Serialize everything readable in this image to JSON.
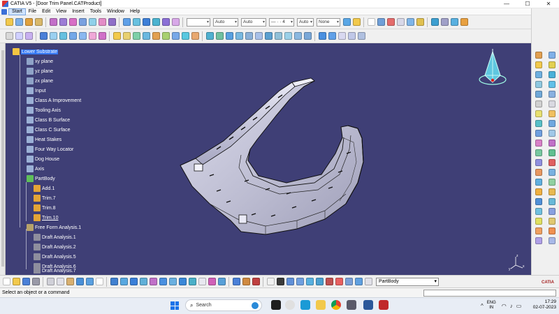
{
  "window": {
    "title": "CATIA V5 - [Door Trim Panel.CATProduct]",
    "controls": [
      "—",
      "☐",
      "✕"
    ]
  },
  "menu": {
    "items": [
      "Start",
      "File",
      "Edit",
      "View",
      "Insert",
      "Tools",
      "Window",
      "Help"
    ]
  },
  "toolbar": {
    "combos": [
      "",
      "Auto",
      "Auto",
      "— · · 4",
      "Auto",
      "None"
    ]
  },
  "tree": {
    "nodes": [
      {
        "label": "Lower Substrate",
        "icon_color": "#f4c542"
      },
      {
        "label": "xy plane",
        "icon_color": "#8fa3c8"
      },
      {
        "label": "yz plane",
        "icon_color": "#8fa3c8"
      },
      {
        "label": "zx plane",
        "icon_color": "#8fa3c8"
      },
      {
        "label": "Input",
        "icon_color": "#9bb0d6"
      },
      {
        "label": "Class A Improvement",
        "icon_color": "#9bb0d6"
      },
      {
        "label": "Tooling Axis",
        "icon_color": "#9bb0d6"
      },
      {
        "label": "Class B Surface",
        "icon_color": "#9bb0d6"
      },
      {
        "label": "Class C Surface",
        "icon_color": "#9bb0d6"
      },
      {
        "label": "Heat Stakes",
        "icon_color": "#9bb0d6"
      },
      {
        "label": "Four Way Locator",
        "icon_color": "#9bb0d6"
      },
      {
        "label": "Dog House",
        "icon_color": "#9bb0d6"
      },
      {
        "label": "Axis",
        "icon_color": "#9bb0d6"
      },
      {
        "label": "PartBody",
        "icon_color": "#5fbf5a"
      },
      {
        "label": "Add.1",
        "icon_color": "#e4a437"
      },
      {
        "label": "Trim.7",
        "icon_color": "#e4a437"
      },
      {
        "label": "Trim.8",
        "icon_color": "#e4a437"
      },
      {
        "label": "Trim.10",
        "icon_color": "#e4a437"
      },
      {
        "label": "Free Form Analysis.1",
        "icon_color": "#b7a26a"
      },
      {
        "label": "Draft Analysis.1",
        "icon_color": "#8e8e9e"
      },
      {
        "label": "Draft Analysis.2",
        "icon_color": "#8e8e9e"
      },
      {
        "label": "Draft Analysis.5",
        "icon_color": "#8e8e9e"
      },
      {
        "label": "Draft Analysis.6",
        "icon_color": "#8e8e9e"
      },
      {
        "label": "Draft Analysis.7",
        "icon_color": "#8e8e9e"
      }
    ]
  },
  "bottom": {
    "current_body": "PartBody",
    "logo": "CATIA"
  },
  "status": {
    "message": "Select an object or a command"
  },
  "taskbar": {
    "search_label": "Search",
    "lang": "ENG",
    "lang_region": "IN",
    "time": "17:29",
    "date": "02-07-2023"
  },
  "colors": {
    "viewport_bg": "#3f3f76",
    "part_fill": "#c9c9dc",
    "selection": "#3478f6"
  },
  "axis_labels": {
    "z": "z",
    "x": "x",
    "y": "y"
  }
}
